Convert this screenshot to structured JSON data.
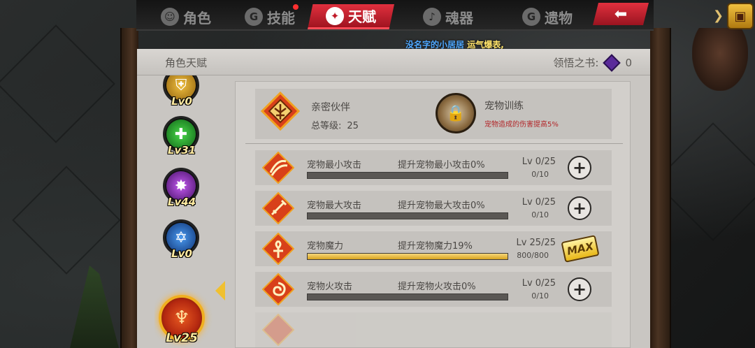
{
  "tabs": [
    {
      "label": "角色",
      "icon": "character-icon",
      "active": false
    },
    {
      "label": "技能",
      "icon": "skill-icon",
      "active": false
    },
    {
      "label": "天赋",
      "icon": "talent-icon",
      "active": true
    },
    {
      "label": "魂器",
      "icon": "soul-vessel-icon",
      "active": false
    },
    {
      "label": "遗物",
      "icon": "relic-icon",
      "active": false
    }
  ],
  "marquee": {
    "name": "没名字的小居居",
    "message": "运气爆表,"
  },
  "panel": {
    "title": "角色天赋",
    "book_label": "领悟之书:",
    "book_count": "0"
  },
  "rail": [
    {
      "level": "Lv0",
      "color": "#d9a020"
    },
    {
      "level": "Lv31",
      "color": "#2ea83a"
    },
    {
      "level": "Lv44",
      "color": "#8a2ac8"
    },
    {
      "level": "Lv0",
      "color": "#2a6ad8"
    }
  ],
  "selected": {
    "level": "Lv25"
  },
  "summary": {
    "name": "亲密伙伴",
    "level_label": "总等级:",
    "level_value": "25",
    "pet_name": "宠物训练",
    "pet_desc": "宠物造成的伤害提高5%"
  },
  "rows": [
    {
      "name": "宠物最小攻击",
      "desc": "提升宠物最小攻击0%",
      "level": "Lv 0/25",
      "count": "0/10",
      "progress": 0,
      "maxed": false
    },
    {
      "name": "宠物最大攻击",
      "desc": "提升宠物最大攻击0%",
      "level": "Lv 0/25",
      "count": "0/10",
      "progress": 0,
      "maxed": false
    },
    {
      "name": "宠物魔力",
      "desc": "提升宠物魔力19%",
      "level": "Lv 25/25",
      "count": "800/800",
      "progress": 1,
      "maxed": true
    },
    {
      "name": "宠物火攻击",
      "desc": "提升宠物火攻击0%",
      "level": "Lv 0/25",
      "count": "0/10",
      "progress": 0,
      "maxed": false
    }
  ],
  "max_label": "MAX"
}
